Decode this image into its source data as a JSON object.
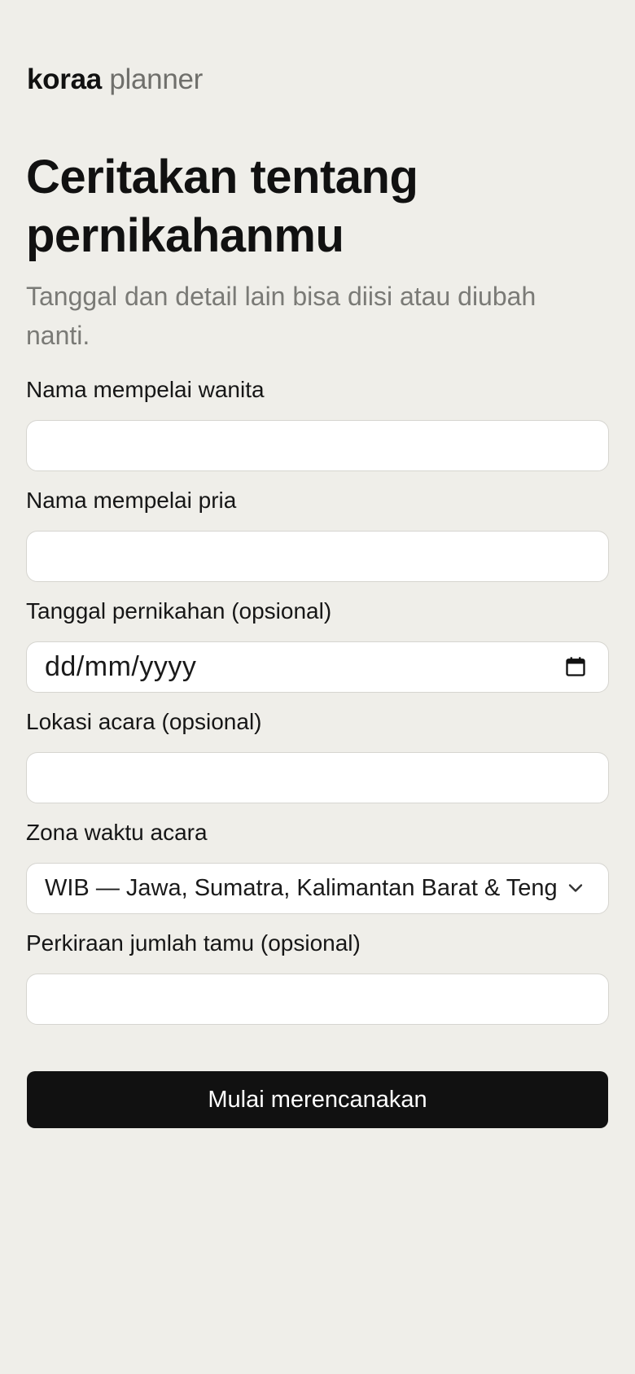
{
  "brand": {
    "name_bold": "koraa",
    "name_light": "planner"
  },
  "header": {
    "title": "Ceritakan tentang pernikahanmu",
    "subtitle": "Tanggal dan detail lain bisa diisi atau diubah nanti."
  },
  "form": {
    "bride_name": {
      "label": "Nama mempelai wanita",
      "value": ""
    },
    "groom_name": {
      "label": "Nama mempelai pria",
      "value": ""
    },
    "wedding_date": {
      "label": "Tanggal pernikahan (opsional)",
      "placeholder": "dd/mm/yyyy",
      "icon": "calendar-icon"
    },
    "location": {
      "label": "Lokasi acara (opsional)",
      "value": ""
    },
    "timezone": {
      "label": "Zona waktu acara",
      "selected": "WIB — Jawa, Sumatra, Kalimantan Barat & Tengah",
      "icon": "chevron-down-icon"
    },
    "guest_count": {
      "label": "Perkiraan jumlah tamu (opsional)",
      "value": ""
    },
    "submit_label": "Mulai merencanakan"
  },
  "colors": {
    "background": "#efeee9",
    "primary_button": "#111111",
    "input_background": "#ffffff",
    "muted_text": "#7a7a76"
  }
}
